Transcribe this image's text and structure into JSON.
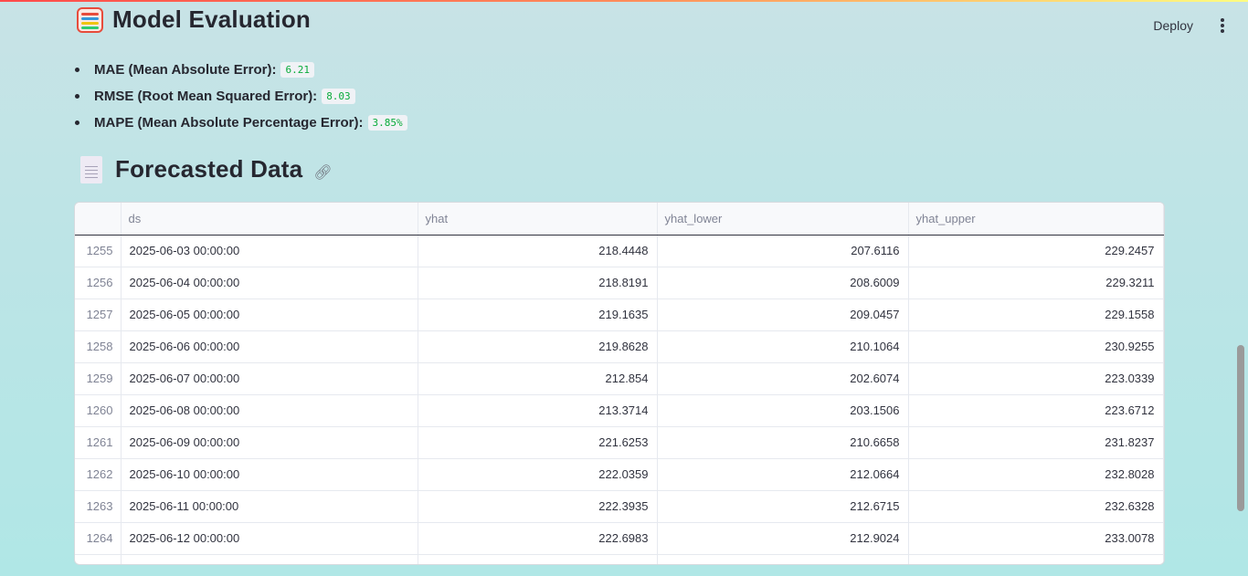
{
  "header": {
    "deploy_label": "Deploy",
    "menu_icon": "kebab-menu-icon"
  },
  "model_eval": {
    "icon": "abacus-icon",
    "title": "Model Evaluation",
    "metrics": [
      {
        "label": "MAE (Mean Absolute Error):",
        "value": "6.21"
      },
      {
        "label": "RMSE (Root Mean Squared Error):",
        "value": "8.03"
      },
      {
        "label": "MAPE (Mean Absolute Percentage Error):",
        "value": "3.85%"
      }
    ]
  },
  "forecast": {
    "icon": "document-icon",
    "title": "Forecasted Data",
    "link_icon": "link-icon",
    "columns": [
      "",
      "ds",
      "yhat",
      "yhat_lower",
      "yhat_upper"
    ],
    "rows": [
      [
        "1255",
        "2025-06-03 00:00:00",
        "218.4448",
        "207.6116",
        "229.2457"
      ],
      [
        "1256",
        "2025-06-04 00:00:00",
        "218.8191",
        "208.6009",
        "229.3211"
      ],
      [
        "1257",
        "2025-06-05 00:00:00",
        "219.1635",
        "209.0457",
        "229.1558"
      ],
      [
        "1258",
        "2025-06-06 00:00:00",
        "219.8628",
        "210.1064",
        "230.9255"
      ],
      [
        "1259",
        "2025-06-07 00:00:00",
        "212.854",
        "202.6074",
        "223.0339"
      ],
      [
        "1260",
        "2025-06-08 00:00:00",
        "213.3714",
        "203.1506",
        "223.6712"
      ],
      [
        "1261",
        "2025-06-09 00:00:00",
        "221.6253",
        "210.6658",
        "231.8237"
      ],
      [
        "1262",
        "2025-06-10 00:00:00",
        "222.0359",
        "212.0664",
        "232.8028"
      ],
      [
        "1263",
        "2025-06-11 00:00:00",
        "222.3935",
        "212.6715",
        "232.6328"
      ],
      [
        "1264",
        "2025-06-12 00:00:00",
        "222.6983",
        "212.9024",
        "233.0078"
      ]
    ]
  }
}
